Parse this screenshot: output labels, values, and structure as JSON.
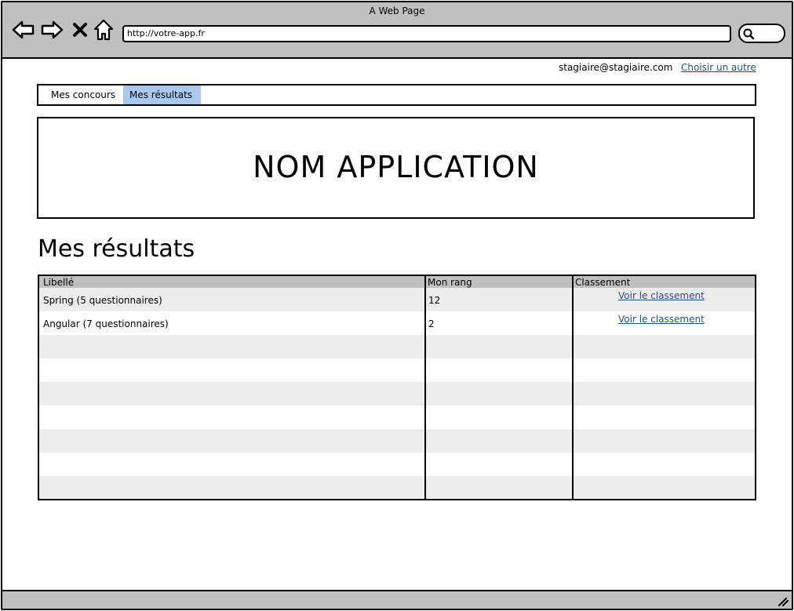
{
  "window": {
    "title": "A Web Page"
  },
  "browser": {
    "icons": [
      "back-arrow-icon",
      "forward-arrow-icon",
      "close-x-icon",
      "home-icon"
    ],
    "url": "http://votre-app.fr"
  },
  "account": {
    "email": "stagiaire@stagiaire.com",
    "choose_other": "Choisir un autre"
  },
  "tabs": [
    {
      "label": "Mes concours",
      "selected": false
    },
    {
      "label": "Mes résultats",
      "selected": true
    }
  ],
  "colors": {
    "selected_tab": "#a8c8f0",
    "link": "#1f4e8c",
    "chrome": "#c0c0c0",
    "row_stripe": "#ececec"
  },
  "banner": {
    "title": "NOM APPLICATION"
  },
  "page": {
    "title": "Mes résultats"
  },
  "table": {
    "headers": [
      "Libellé",
      "Mon rang",
      "Classement"
    ],
    "rows": [
      {
        "libelle": "Spring (5 questionnaires)",
        "rang": "12",
        "classement": "Voir le classement"
      },
      {
        "libelle": "Angular (7 questionnaires)",
        "rang": "2",
        "classement": "Voir le classement"
      }
    ]
  }
}
